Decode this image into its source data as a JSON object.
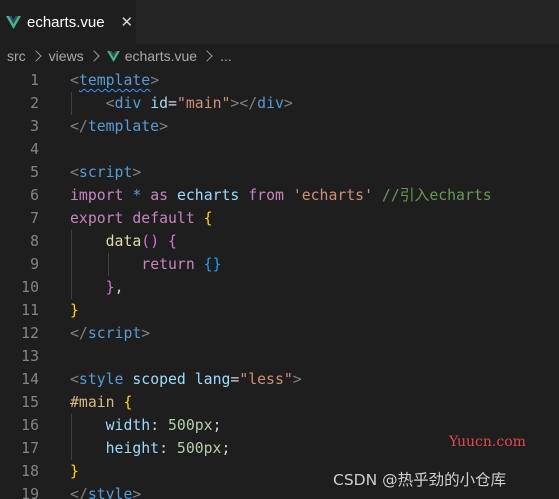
{
  "tab": {
    "title": "echarts.vue",
    "close_glyph": "✕",
    "icon": "vue-icon",
    "icon_color": "#41b883"
  },
  "breadcrumb": {
    "items": [
      "src",
      "views",
      "echarts.vue",
      "..."
    ]
  },
  "editor": {
    "line_numbers": [
      "1",
      "2",
      "3",
      "4",
      "5",
      "6",
      "7",
      "8",
      "9",
      "10",
      "11",
      "12",
      "13",
      "14",
      "15",
      "16",
      "17",
      "18",
      "19"
    ],
    "lines": [
      [
        {
          "t": "<",
          "c": "punc"
        },
        {
          "t": "template",
          "c": "tag squiggle"
        },
        {
          "t": ">",
          "c": "punc"
        }
      ],
      [
        {
          "t": "    ",
          "c": "def"
        },
        {
          "t": "<",
          "c": "punc"
        },
        {
          "t": "div",
          "c": "tag"
        },
        {
          "t": " ",
          "c": "def"
        },
        {
          "t": "id",
          "c": "attr"
        },
        {
          "t": "=",
          "c": "def"
        },
        {
          "t": "\"main\"",
          "c": "str"
        },
        {
          "t": "></",
          "c": "punc"
        },
        {
          "t": "div",
          "c": "tag"
        },
        {
          "t": ">",
          "c": "punc"
        }
      ],
      [
        {
          "t": "</",
          "c": "punc"
        },
        {
          "t": "template",
          "c": "tag"
        },
        {
          "t": ">",
          "c": "punc"
        }
      ],
      [],
      [
        {
          "t": "<",
          "c": "punc"
        },
        {
          "t": "script",
          "c": "tag"
        },
        {
          "t": ">",
          "c": "punc"
        }
      ],
      [
        {
          "t": "import",
          "c": "kw"
        },
        {
          "t": " ",
          "c": "def"
        },
        {
          "t": "*",
          "c": "tag"
        },
        {
          "t": " ",
          "c": "def"
        },
        {
          "t": "as",
          "c": "kw"
        },
        {
          "t": " ",
          "c": "def"
        },
        {
          "t": "echarts",
          "c": "var"
        },
        {
          "t": " ",
          "c": "def"
        },
        {
          "t": "from",
          "c": "kw"
        },
        {
          "t": " ",
          "c": "def"
        },
        {
          "t": "'echarts'",
          "c": "str"
        },
        {
          "t": " ",
          "c": "def"
        },
        {
          "t": "//引入echarts",
          "c": "comment"
        }
      ],
      [
        {
          "t": "export",
          "c": "kw"
        },
        {
          "t": " ",
          "c": "def"
        },
        {
          "t": "default",
          "c": "kw"
        },
        {
          "t": " ",
          "c": "def"
        },
        {
          "t": "{",
          "c": "b1"
        }
      ],
      [
        {
          "t": "    ",
          "c": "def"
        },
        {
          "t": "data",
          "c": "fn"
        },
        {
          "t": "()",
          "c": "b2"
        },
        {
          "t": " ",
          "c": "def"
        },
        {
          "t": "{",
          "c": "b2"
        }
      ],
      [
        {
          "t": "        ",
          "c": "def"
        },
        {
          "t": "return",
          "c": "kw"
        },
        {
          "t": " ",
          "c": "def"
        },
        {
          "t": "{}",
          "c": "b3"
        }
      ],
      [
        {
          "t": "    ",
          "c": "def"
        },
        {
          "t": "}",
          "c": "b2"
        },
        {
          "t": ",",
          "c": "def"
        }
      ],
      [
        {
          "t": "}",
          "c": "b1"
        }
      ],
      [
        {
          "t": "</",
          "c": "punc"
        },
        {
          "t": "script",
          "c": "tag"
        },
        {
          "t": ">",
          "c": "punc"
        }
      ],
      [],
      [
        {
          "t": "<",
          "c": "punc"
        },
        {
          "t": "style",
          "c": "tag"
        },
        {
          "t": " ",
          "c": "def"
        },
        {
          "t": "scoped",
          "c": "attr"
        },
        {
          "t": " ",
          "c": "def"
        },
        {
          "t": "lang",
          "c": "attr"
        },
        {
          "t": "=",
          "c": "def"
        },
        {
          "t": "\"less\"",
          "c": "str"
        },
        {
          "t": ">",
          "c": "punc"
        }
      ],
      [
        {
          "t": "#main",
          "c": "sel"
        },
        {
          "t": " ",
          "c": "def"
        },
        {
          "t": "{",
          "c": "b1"
        }
      ],
      [
        {
          "t": "    ",
          "c": "def"
        },
        {
          "t": "width",
          "c": "prop"
        },
        {
          "t": ": ",
          "c": "def"
        },
        {
          "t": "500px",
          "c": "num"
        },
        {
          "t": ";",
          "c": "def"
        }
      ],
      [
        {
          "t": "    ",
          "c": "def"
        },
        {
          "t": "height",
          "c": "prop"
        },
        {
          "t": ": ",
          "c": "def"
        },
        {
          "t": "500px",
          "c": "num"
        },
        {
          "t": ";",
          "c": "def"
        }
      ],
      [
        {
          "t": "}",
          "c": "b1"
        }
      ],
      [
        {
          "t": "</",
          "c": "punc"
        },
        {
          "t": "style",
          "c": "tag"
        },
        {
          "t": ">",
          "c": "punc"
        }
      ]
    ]
  },
  "watermarks": {
    "site": "Yuucn.com",
    "csdn": "CSDN @热乎劲的小仓库"
  },
  "colors": {
    "editor_bg": "#1e1e1e",
    "tab_bar_bg": "#252526",
    "line_number": "#858585",
    "site_watermark": "#e5484d"
  }
}
